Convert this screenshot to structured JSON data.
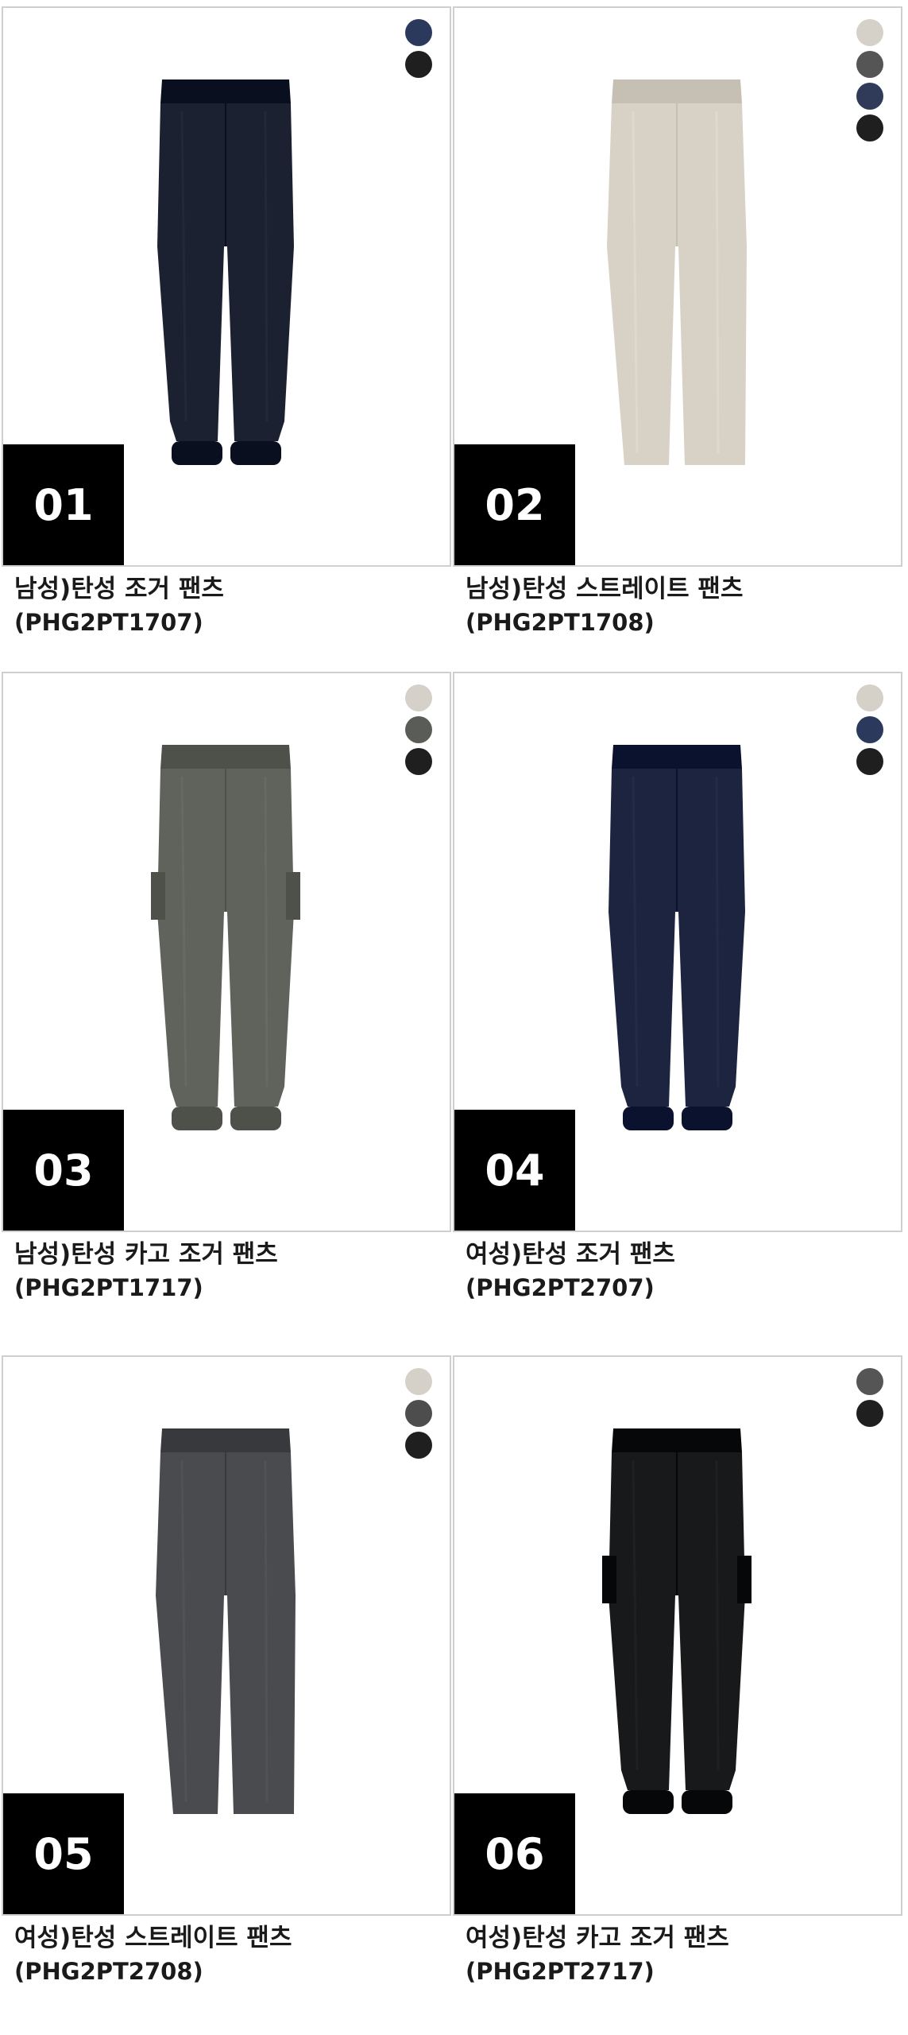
{
  "products": [
    {
      "number": "01",
      "title": "남성)탄성 조거 팬츠",
      "code": "(PHG2PT1707)",
      "pants_color": "#1b2130",
      "style": "jogger",
      "swatches": [
        "#2b3a5c",
        "#1f1f1f"
      ]
    },
    {
      "number": "02",
      "title": "남성)탄성 스트레이트 팬츠",
      "code": "(PHG2PT1708)",
      "pants_color": "#d8d1c6",
      "style": "straight",
      "swatches": [
        "#d6d1c8",
        "#555555",
        "#2f3b58",
        "#1f1f1f"
      ]
    },
    {
      "number": "03",
      "title": "남성)탄성 카고 조거 팬츠",
      "code": "(PHG2PT1717)",
      "pants_color": "#5f635b",
      "style": "cargo",
      "swatches": [
        "#d6d1c8",
        "#5a5d57",
        "#1f1f1f"
      ]
    },
    {
      "number": "04",
      "title": "여성)탄성 조거 팬츠",
      "code": "(PHG2PT2707)",
      "pants_color": "#1c2440",
      "style": "jogger",
      "swatches": [
        "#d6d1c8",
        "#2b3a5c",
        "#1f1f1f"
      ]
    },
    {
      "number": "05",
      "title": "여성)탄성 스트레이트 팬츠",
      "code": "(PHG2PT2708)",
      "pants_color": "#4a4b4e",
      "style": "straight",
      "swatches": [
        "#d6d1c8",
        "#4d4d4d",
        "#1f1f1f"
      ]
    },
    {
      "number": "06",
      "title": "여성)탄성 카고 조거 팬츠",
      "code": "(PHG2PT2717)",
      "pants_color": "#18191b",
      "style": "cargo",
      "swatches": [
        "#555555",
        "#1f1f1f"
      ]
    }
  ]
}
